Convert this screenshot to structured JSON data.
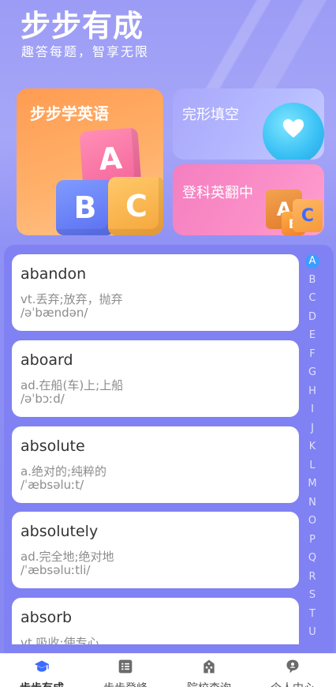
{
  "header": {
    "title": "步步有成",
    "subtitle": "趣答每题，智享无限"
  },
  "cards": {
    "main": {
      "title": "步步学英语",
      "blocks": [
        "A",
        "B",
        "C"
      ]
    },
    "cloze": {
      "title": "完形填空"
    },
    "translate": {
      "title": "登科英翻中",
      "blocks": [
        "A",
        "B",
        "C"
      ]
    }
  },
  "words": [
    {
      "word": "abandon",
      "meaning": "vt.丢弃;放弃，抛弃",
      "phonetic": "/əˈbændən/"
    },
    {
      "word": "aboard",
      "meaning": "ad.在船(车)上;上船",
      "phonetic": "/əˈbɔːd/"
    },
    {
      "word": "absolute",
      "meaning": "a.绝对的;纯粹的",
      "phonetic": "/ˈæbsəluːt/"
    },
    {
      "word": "absolutely",
      "meaning": "ad.完全地;绝对地",
      "phonetic": "/ˈæbsəluːtli/"
    },
    {
      "word": "absorb",
      "meaning": "vt.吸收;使专心",
      "phonetic": ""
    }
  ],
  "alphabet": {
    "active": "A",
    "letters": [
      "A",
      "B",
      "C",
      "D",
      "E",
      "F",
      "G",
      "H",
      "I",
      "J",
      "K",
      "L",
      "M",
      "N",
      "O",
      "P",
      "Q",
      "R",
      "S",
      "T",
      "U"
    ]
  },
  "tabs": [
    {
      "label": "步步有成",
      "icon": "graduation-cap-icon",
      "active": true
    },
    {
      "label": "步步登峰",
      "icon": "list-icon",
      "active": false
    },
    {
      "label": "院校查询",
      "icon": "school-building-icon",
      "active": false
    },
    {
      "label": "个人中心",
      "icon": "user-bubble-icon",
      "active": false
    }
  ],
  "colors": {
    "accent": "#8081f2",
    "active_index": "#3d9cff",
    "card_main": "#ff9c52",
    "card_cloze": "#b6bbff",
    "card_translate": "#fb8fc8"
  }
}
